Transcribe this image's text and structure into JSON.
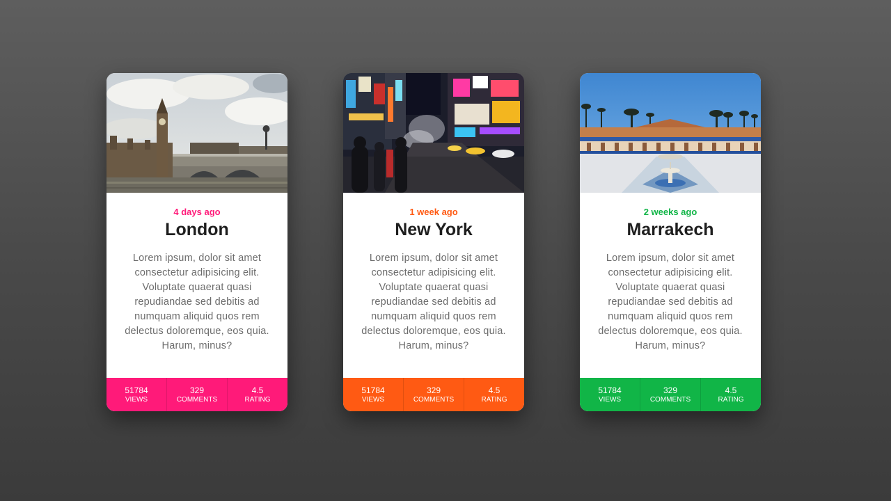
{
  "cards": [
    {
      "date": "4 days ago",
      "title": "London",
      "description": "Lorem ipsum, dolor sit amet consectetur adipisicing elit. Voluptate quaerat quasi repudiandae sed debitis ad numquam aliquid quos rem delectus doloremque, eos quia. Harum, minus?",
      "accent_color": "#ff1a79",
      "photo": "london-bridge-big-ben-photo",
      "stats": [
        {
          "value": "51784",
          "label": "VIEWS"
        },
        {
          "value": "329",
          "label": "COMMENTS"
        },
        {
          "value": "4.5",
          "label": "RATING"
        }
      ]
    },
    {
      "date": "1 week ago",
      "title": "New York",
      "description": "Lorem ipsum, dolor sit amet consectetur adipisicing elit. Voluptate quaerat quasi repudiandae sed debitis ad numquam aliquid quos rem delectus doloremque, eos quia. Harum, minus?",
      "accent_color": "#ff5a13",
      "photo": "times-square-night-photo",
      "stats": [
        {
          "value": "51784",
          "label": "VIEWS"
        },
        {
          "value": "329",
          "label": "COMMENTS"
        },
        {
          "value": "4.5",
          "label": "RATING"
        }
      ]
    },
    {
      "date": "2 weeks ago",
      "title": "Marrakech",
      "description": "Lorem ipsum, dolor sit amet consectetur adipisicing elit. Voluptate quaerat quasi repudiandae sed debitis ad numquam aliquid quos rem delectus doloremque, eos quia. Harum, minus?",
      "accent_color": "#11b547",
      "photo": "courtyard-fountain-palms-photo",
      "stats": [
        {
          "value": "51784",
          "label": "VIEWS"
        },
        {
          "value": "329",
          "label": "COMMENTS"
        },
        {
          "value": "4.5",
          "label": "RATING"
        }
      ]
    }
  ]
}
